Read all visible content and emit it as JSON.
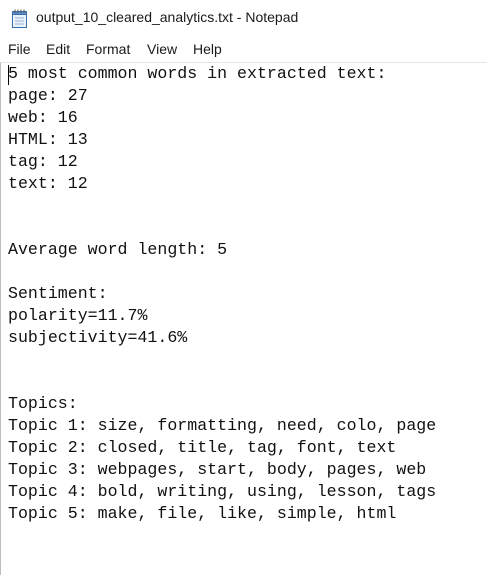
{
  "window": {
    "title": "output_10_cleared_analytics.txt - Notepad",
    "app_icon": "notepad-icon"
  },
  "menu": {
    "items": [
      "File",
      "Edit",
      "Format",
      "View",
      "Help"
    ]
  },
  "editor": {
    "lines": [
      "5 most common words in extracted text:",
      "page: 27",
      "web: 16",
      "HTML: 13",
      "tag: 12",
      "text: 12",
      "",
      "",
      "Average word length: 5",
      "",
      "Sentiment:",
      "polarity=11.7%",
      "subjectivity=41.6%",
      "",
      "",
      "Topics:",
      "Topic 1: size, formatting, need, colo, page",
      "Topic 2: closed, title, tag, font, text",
      "Topic 3: webpages, start, body, pages, web",
      "Topic 4: bold, writing, using, lesson, tags",
      "Topic 5: make, file, like, simple, html"
    ]
  },
  "colors": {
    "text": "#111111",
    "background": "#ffffff",
    "icon_blue": "#2b6cb0"
  }
}
